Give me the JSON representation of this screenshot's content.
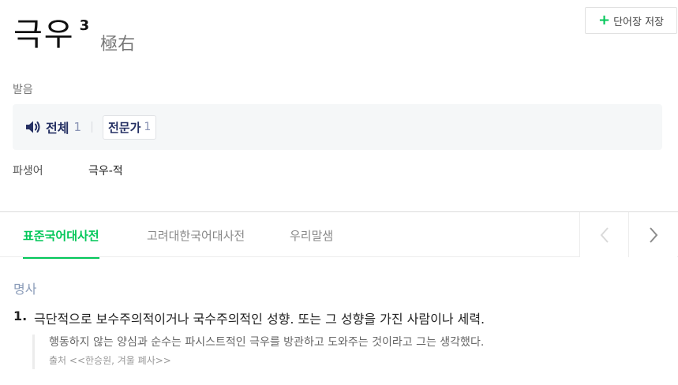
{
  "toolbar": {
    "save_label": "단어장 저장",
    "save_icon": "plus-icon"
  },
  "entry": {
    "word": "극우",
    "homonym_number": "3",
    "hanja": "極右"
  },
  "pronunciation": {
    "label": "발음",
    "all_label": "전체",
    "all_count": "1",
    "expert_label": "전문가",
    "expert_count": "1",
    "icon": "speaker-icon",
    "text_color": "#253063"
  },
  "derivative": {
    "label": "파생어",
    "value": "극우-적"
  },
  "tabs": [
    {
      "label": "표준국어대사전",
      "active": true
    },
    {
      "label": "고려대한국어대사전",
      "active": false
    },
    {
      "label": "우리말샘",
      "active": false
    }
  ],
  "colors": {
    "accent": "#03c75a",
    "pos": "#8a9bb8"
  },
  "definition": {
    "pos": "명사",
    "number": "1.",
    "text": "극단적으로 보수주의적이거나 국수주의적인 성향. 또는 그 성향을 가진 사람이나 세력.",
    "example": "행동하지 않는 양심과 순수는 파시스트적인 극우를 방관하고 도와주는 것이라고 그는 생각했다.",
    "source": "출처 <<한승원, 겨울 폐사>>"
  }
}
